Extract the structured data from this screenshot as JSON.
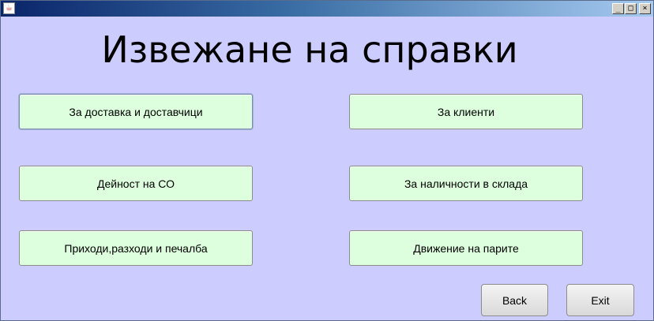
{
  "window": {
    "title": "",
    "app_icon": "java-cup-icon",
    "controls": {
      "minimize": "_",
      "maximize": "□",
      "close": "×"
    }
  },
  "heading": "Извежане на справки",
  "buttons": {
    "deliveries": "За доставка и доставчици",
    "clients": "За клиенти",
    "activity": "Дейност на СО",
    "stock": "За наличности в склада",
    "income": "Приходи,разходи и печалба",
    "cashflow": "Движение на парите",
    "back": "Back",
    "exit": "Exit"
  },
  "colors": {
    "background": "#ccccff",
    "button_fill": "#ddffdd"
  }
}
